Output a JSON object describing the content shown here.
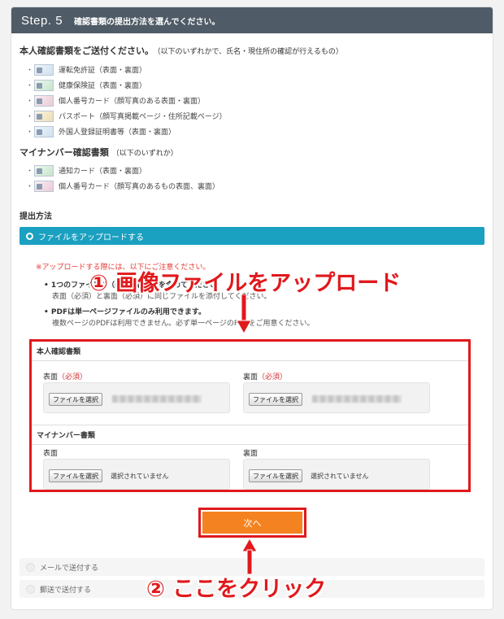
{
  "step": {
    "number": "Step. 5",
    "title": "確認書類の提出方法を選んでください。"
  },
  "identity": {
    "heading": "本人確認書類をご送付ください。",
    "note": "（以下のいずれかで、氏名・現住所の確認が行えるもの）",
    "items": [
      "運転免許証（表面・裏面）",
      "健康保険証（表面・裏面）",
      "個人番号カード（顔写真のある表面・裏面）",
      "パスポート（顔写真掲載ページ・住所記載ページ）",
      "外国人登録証明書等（表面・裏面）"
    ]
  },
  "mynumber": {
    "heading": "マイナンバー確認書類",
    "note": "（以下のいずれか）",
    "items": [
      "通知カード（表面・裏面）",
      "個人番号カード（顔写真のあるもの表面、裏面）"
    ]
  },
  "method": {
    "heading": "提出方法",
    "upload_label": "ファイルをアップロードする",
    "notice": "※アップロードする際には、以下にご注意ください。",
    "bullet1": "1つのファイルに（表面・裏面）を含めてください",
    "bullet1_sub": "表面（必須）と裏面（必須）に同じファイルを添付してください。",
    "bullet2": "PDFは単一ページファイルのみ利用できます。",
    "bullet2_sub": "複数ページのPDFは利用できません。必ず単一ページのPDFをご用意ください。"
  },
  "form": {
    "identity_title": "本人確認書類",
    "front": "表面",
    "back": "裏面",
    "required": "（必須）",
    "choose_file": "ファイルを選択",
    "mynumber_title": "マイナンバー書類",
    "no_file": "選択されていません"
  },
  "next_label": "次へ",
  "options": {
    "mail": "メールで送付する",
    "post": "郵送で送付する"
  },
  "annotations": {
    "step1": "① 画像ファイルをアップロード",
    "step2": "② ここをクリック"
  },
  "colors": {
    "header": "#4f5b66",
    "accent": "#1aa0c0",
    "next": "#f58220",
    "annotation": "#e0191c"
  }
}
